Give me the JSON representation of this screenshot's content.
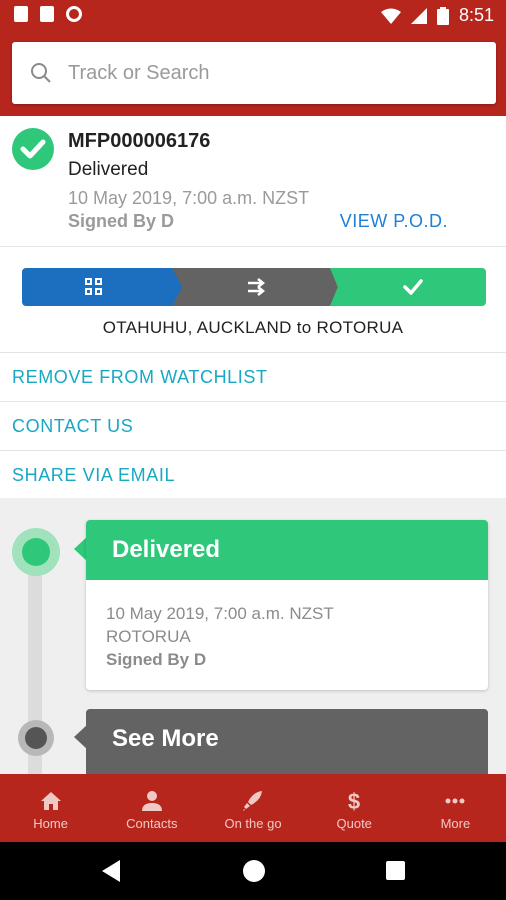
{
  "status_bar": {
    "time": "8:51"
  },
  "search": {
    "placeholder": "Track or Search"
  },
  "shipment": {
    "tracking_number": "MFP000006176",
    "status": "Delivered",
    "datetime": "10 May 2019, 7:00 a.m. NZST",
    "signed_by": "Signed By D",
    "view_pod": "VIEW P.O.D."
  },
  "progress": {
    "stages": [
      "barcode-icon",
      "transfer-arrows-icon",
      "check-icon"
    ],
    "colors": [
      "#1c6fbf",
      "#636363",
      "#2fc77a"
    ],
    "route": "OTAHUHU, AUCKLAND to ROTORUA"
  },
  "actions": {
    "remove_watchlist": "REMOVE FROM WATCHLIST",
    "contact_us": "CONTACT US",
    "share_email": "SHARE VIA EMAIL"
  },
  "timeline": {
    "event1": {
      "title": "Delivered",
      "datetime": "10 May 2019, 7:00 a.m. NZST",
      "location": "ROTORUA",
      "signed_by": "Signed By D"
    },
    "see_more": "See More"
  },
  "bottom_nav": {
    "items": [
      {
        "label": "Home",
        "icon": "home-icon"
      },
      {
        "label": "Contacts",
        "icon": "person-icon"
      },
      {
        "label": "On the go",
        "icon": "rocket-icon"
      },
      {
        "label": "Quote",
        "icon": "dollar-icon"
      },
      {
        "label": "More",
        "icon": "more-dots-icon"
      }
    ]
  },
  "colors": {
    "brand_red": "#b7261d",
    "delivered_green": "#2fc77a",
    "link_blue": "#1e7fd6",
    "action_cyan": "#18a8c4"
  }
}
